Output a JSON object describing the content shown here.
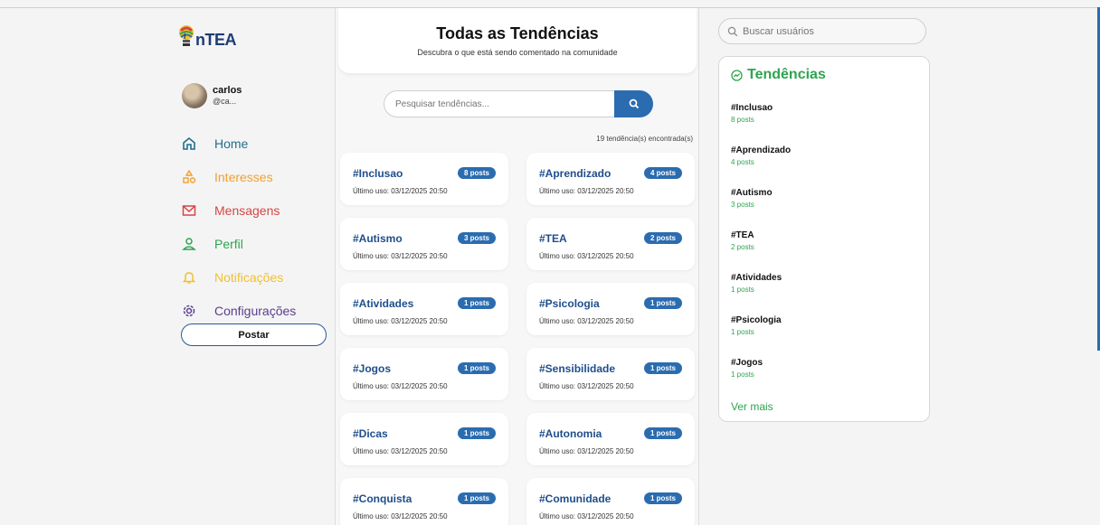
{
  "app": {
    "logo_text": "nTEA",
    "logo_prefix": "i"
  },
  "profile": {
    "name": "carlos",
    "handle": "@ca..."
  },
  "nav": [
    {
      "label": "Home",
      "icon": "home-icon",
      "color": "#1f6f8b"
    },
    {
      "label": "Interesses",
      "icon": "shapes-icon",
      "color": "#f0a030"
    },
    {
      "label": "Mensagens",
      "icon": "mail-icon",
      "color": "#d64545"
    },
    {
      "label": "Perfil",
      "icon": "user-icon",
      "color": "#2ea44f"
    },
    {
      "label": "Notificações",
      "icon": "bell-icon",
      "color": "#f2c12e"
    },
    {
      "label": "Configurações",
      "icon": "gear-icon",
      "color": "#5a3e8e"
    }
  ],
  "post_button": "Postar",
  "center": {
    "title": "Todas as Tendências",
    "subtitle": "Descubra o que está sendo comentado na comunidade",
    "search_placeholder": "Pesquisar tendências...",
    "count_text": "19 tendência(s) encontrada(s)",
    "cards": [
      {
        "tag": "#Inclusao",
        "badge": "8 posts",
        "date": "Último uso: 03/12/2025 20:50"
      },
      {
        "tag": "#Aprendizado",
        "badge": "4 posts",
        "date": "Último uso: 03/12/2025 20:50"
      },
      {
        "tag": "#Autismo",
        "badge": "3 posts",
        "date": "Último uso: 03/12/2025 20:50"
      },
      {
        "tag": "#TEA",
        "badge": "2 posts",
        "date": "Último uso: 03/12/2025 20:50"
      },
      {
        "tag": "#Atividades",
        "badge": "1 posts",
        "date": "Último uso: 03/12/2025 20:50"
      },
      {
        "tag": "#Psicologia",
        "badge": "1 posts",
        "date": "Último uso: 03/12/2025 20:50"
      },
      {
        "tag": "#Jogos",
        "badge": "1 posts",
        "date": "Último uso: 03/12/2025 20:50"
      },
      {
        "tag": "#Sensibilidade",
        "badge": "1 posts",
        "date": "Último uso: 03/12/2025 20:50"
      },
      {
        "tag": "#Dicas",
        "badge": "1 posts",
        "date": "Último uso: 03/12/2025 20:50"
      },
      {
        "tag": "#Autonomia",
        "badge": "1 posts",
        "date": "Último uso: 03/12/2025 20:50"
      },
      {
        "tag": "#Conquista",
        "badge": "1 posts",
        "date": "Último uso: 03/12/2025 20:50"
      },
      {
        "tag": "#Comunidade",
        "badge": "1 posts",
        "date": "Último uso: 03/12/2025 20:50"
      }
    ]
  },
  "right": {
    "search_placeholder": "Buscar usuários",
    "trends_title": "Tendências",
    "trends": [
      {
        "tag": "#Inclusao",
        "posts": "8 posts"
      },
      {
        "tag": "#Aprendizado",
        "posts": "4 posts"
      },
      {
        "tag": "#Autismo",
        "posts": "3 posts"
      },
      {
        "tag": "#TEA",
        "posts": "2 posts"
      },
      {
        "tag": "#Atividades",
        "posts": "1 posts"
      },
      {
        "tag": "#Psicologia",
        "posts": "1 posts"
      },
      {
        "tag": "#Jogos",
        "posts": "1 posts"
      }
    ],
    "see_more": "Ver mais"
  },
  "colors": {
    "accent": "#2b6cb0",
    "green": "#2ea44f",
    "tag_blue": "#1f4e8c"
  }
}
